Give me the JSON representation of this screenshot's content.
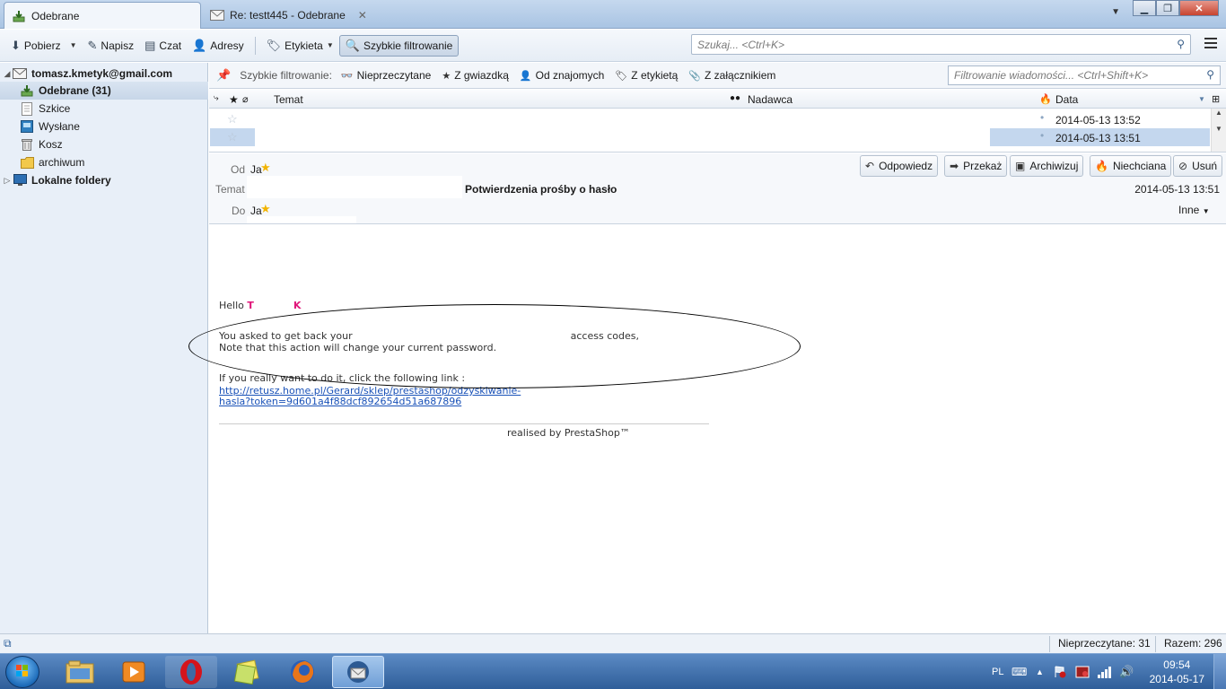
{
  "tabs": [
    {
      "label": "Odebrane",
      "icon": "inbox-icon",
      "active": true
    },
    {
      "label": "Re: testt445 - Odebrane",
      "icon": "envelope-icon",
      "active": false
    }
  ],
  "toolbar": {
    "get_mail": "Pobierz",
    "write": "Napisz",
    "chat": "Czat",
    "address_book": "Adresy",
    "tag": "Etykieta",
    "quick_filter": "Szybkie filtrowanie",
    "search_placeholder": "Szukaj... <Ctrl+K>"
  },
  "folders": {
    "account": "tomasz.kmetyk@gmail.com",
    "items": [
      {
        "label": "Odebrane (31)",
        "icon": "inbox-icon"
      },
      {
        "label": "Szkice",
        "icon": "drafts-icon"
      },
      {
        "label": "Wysłane",
        "icon": "sent-icon"
      },
      {
        "label": "Kosz",
        "icon": "trash-icon"
      },
      {
        "label": "archiwum",
        "icon": "folder-icon"
      }
    ],
    "local": "Lokalne foldery"
  },
  "quick_filter": {
    "label": "Szybkie filtrowanie:",
    "unread": "Nieprzeczytane",
    "starred": "Z gwiazdką",
    "contacts": "Od znajomych",
    "tags": "Z etykietą",
    "attachments": "Z załącznikiem",
    "search_placeholder": "Filtrowanie wiadomości... <Ctrl+Shift+K>"
  },
  "thread_columns": {
    "subject": "Temat",
    "sender": "Nadawca",
    "date": "Data"
  },
  "threads": [
    {
      "date": "2014-05-13 13:52"
    },
    {
      "date": "2014-05-13 13:51"
    }
  ],
  "message_header": {
    "from_label": "Od",
    "from_value": "Ja",
    "subject_label": "Temat",
    "subject": "Potwierdzenia prośby o hasło",
    "to_label": "Do",
    "to_value": "Ja",
    "date": "2014-05-13 13:51",
    "other": "Inne",
    "actions": {
      "reply": "Odpowiedz",
      "forward": "Przekaż",
      "archive": "Archiwizuj",
      "junk": "Niechciana",
      "delete": "Usuń"
    }
  },
  "message_body": {
    "greeting": "Hello",
    "name_first": "T",
    "name_last": "K",
    "line1_a": "You asked to get back your",
    "line1_b": "access codes,",
    "line2": "Note that this action will change your current password.",
    "line3": "If you really want to do it, click the following link :",
    "link_line1": "http://retusz.home.pl/Gerard/sklep/prestashop/odzyskiwanie-",
    "link_line2": "hasla?token=9d601a4f88dcf892654d51a687896",
    "footer": "realised by PrestaShop™"
  },
  "statusbar": {
    "unread": "Nieprzeczytane: 31",
    "total": "Razem: 296"
  },
  "taskbar": {
    "lang": "PL",
    "time": "09:54",
    "date": "2014-05-17"
  }
}
